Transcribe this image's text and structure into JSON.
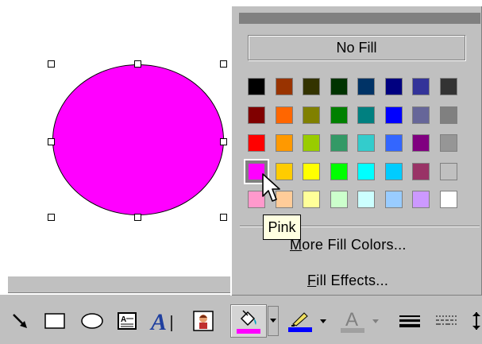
{
  "shape": {
    "fill": "#ff00ff"
  },
  "popup": {
    "no_fill_label": "No Fill",
    "more_colors_label": "More Fill Colors...",
    "more_colors_mnemonic": "M",
    "more_colors_rest": "ore Fill Colors...",
    "fill_effects_label": "Fill Effects...",
    "fill_effects_mnemonic": "F",
    "fill_effects_rest": "ill Effects...",
    "palette": [
      [
        "#000000",
        "#993300",
        "#333300",
        "#003300",
        "#003366",
        "#000080",
        "#333399",
        "#333333"
      ],
      [
        "#800000",
        "#ff6600",
        "#808000",
        "#008000",
        "#008080",
        "#0000ff",
        "#666699",
        "#808080"
      ],
      [
        "#ff0000",
        "#ff9900",
        "#99cc00",
        "#339966",
        "#33cccc",
        "#3366ff",
        "#800080",
        "#969696"
      ],
      [
        "#ff00ff",
        "#ffcc00",
        "#ffff00",
        "#00ff00",
        "#00ffff",
        "#00ccff",
        "#993366",
        "#c0c0c0"
      ],
      [
        "#ff99cc",
        "#ffcc99",
        "#ffff99",
        "#ccffcc",
        "#ccffff",
        "#99ccff",
        "#cc99ff",
        "#ffffff"
      ]
    ],
    "selected": {
      "row": 3,
      "col": 0
    }
  },
  "tooltip": {
    "text": "Pink"
  },
  "toolbar": {
    "fill_color_bar": "#ff00ff",
    "line_color_bar": "#0000ff",
    "font_color_bar": "#c0c0c0",
    "icons": [
      "arrow-icon",
      "rectangle-icon",
      "oval-icon",
      "text-box-icon",
      "wordart-icon",
      "clip-art-icon",
      "fill-color-icon",
      "line-color-icon",
      "font-color-icon",
      "line-style-icon",
      "dash-style-icon"
    ]
  }
}
